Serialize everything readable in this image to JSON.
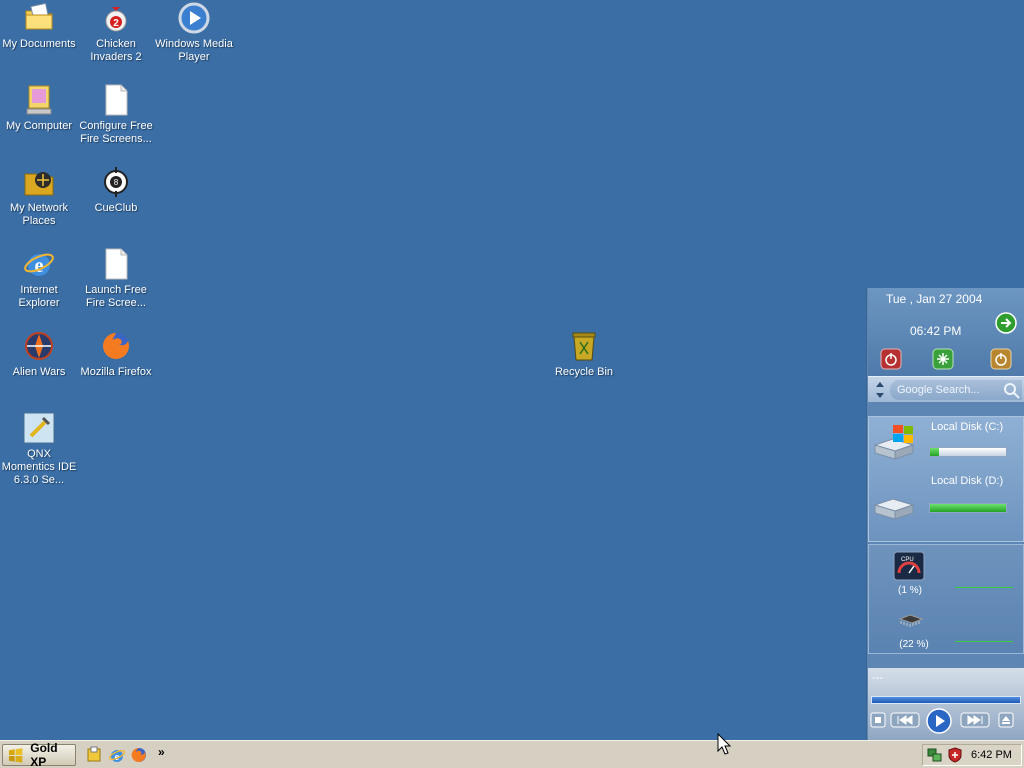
{
  "desktop": {
    "icons": {
      "my_documents": "My Documents",
      "chicken_invaders": "Chicken Invaders 2",
      "wmp": "Windows Media Player",
      "my_computer": "My Computer",
      "configure_ffs": "Configure Free Fire Screens...",
      "network": "My Network Places",
      "cueclub": "CueClub",
      "ie": "Internet Explorer",
      "launch_ffs": "Launch Free Fire Scree...",
      "alien_wars": "Alien Wars",
      "firefox": "Mozilla Firefox",
      "qnx": "QNX Momentics IDE 6.3.0 Se...",
      "recycle_bin": "Recycle Bin"
    }
  },
  "sidebar": {
    "date": "Tue , Jan 27 2004",
    "time": "06:42 PM",
    "search_placeholder": "Google Search...",
    "disk_c": {
      "label": "Local Disk (C:)",
      "used_fraction": 0.12
    },
    "disk_d": {
      "label": "Local Disk (D:)",
      "used_fraction": 1.0
    },
    "cpu_icon_text": "CPU",
    "cpu_load": "(1 %)",
    "mem_load": "(22 %)",
    "media_title": "---"
  },
  "taskbar": {
    "start_label": "Gold XP",
    "clock": "6:42 PM",
    "chevron": "»"
  },
  "colors": {
    "desktop": "#3a6ea5",
    "taskbar": "#d5d0c1",
    "sidebar": "#5d86b4"
  }
}
